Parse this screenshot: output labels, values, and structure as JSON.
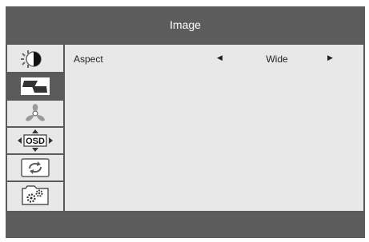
{
  "window": {
    "title": "Image"
  },
  "sidebar": {
    "items": [
      {
        "name": "brightness",
        "icon": "brightness-contrast-icon",
        "selected": false
      },
      {
        "name": "image",
        "icon": "image-icon",
        "selected": true
      },
      {
        "name": "color",
        "icon": "color-icon",
        "selected": false
      },
      {
        "name": "osd",
        "icon": "osd-icon",
        "label": "OSD",
        "selected": false
      },
      {
        "name": "reset",
        "icon": "reset-icon",
        "selected": false
      },
      {
        "name": "setup",
        "icon": "gear-icon",
        "selected": false
      }
    ]
  },
  "content": {
    "rows": [
      {
        "label": "Aspect",
        "value": "Wide",
        "left_arrow": "◀",
        "right_arrow": "▶"
      }
    ]
  },
  "colors": {
    "frame": "#5a5a5a",
    "panel": "#e8e8e8",
    "selected": "#5a5a5a",
    "text": "#222222",
    "title_text": "#ffffff"
  }
}
